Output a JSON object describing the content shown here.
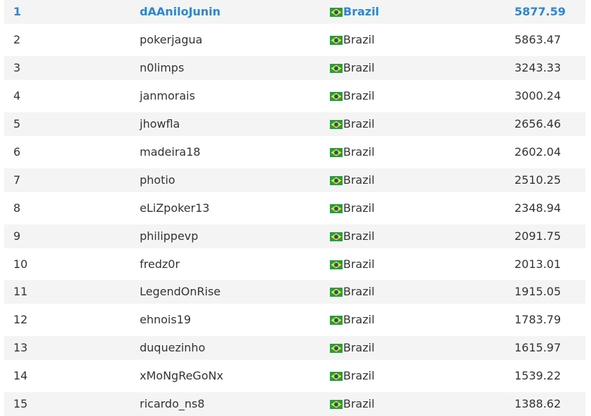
{
  "leaderboard": {
    "rows": [
      {
        "rank": "1",
        "player": "dAAniloJunin",
        "country": "Brazil",
        "score": "5877.59"
      },
      {
        "rank": "2",
        "player": "pokerjagua",
        "country": "Brazil",
        "score": "5863.47"
      },
      {
        "rank": "3",
        "player": "n0limps",
        "country": "Brazil",
        "score": "3243.33"
      },
      {
        "rank": "4",
        "player": "janmorais",
        "country": "Brazil",
        "score": "3000.24"
      },
      {
        "rank": "5",
        "player": "jhowfla",
        "country": "Brazil",
        "score": "2656.46"
      },
      {
        "rank": "6",
        "player": "madeira18",
        "country": "Brazil",
        "score": "2602.04"
      },
      {
        "rank": "7",
        "player": "photio",
        "country": "Brazil",
        "score": "2510.25"
      },
      {
        "rank": "8",
        "player": "eLiZpoker13",
        "country": "Brazil",
        "score": "2348.94"
      },
      {
        "rank": "9",
        "player": "philippevp",
        "country": "Brazil",
        "score": "2091.75"
      },
      {
        "rank": "10",
        "player": "fredz0r",
        "country": "Brazil",
        "score": "2013.01"
      },
      {
        "rank": "11",
        "player": "LegendOnRise",
        "country": "Brazil",
        "score": "1915.05"
      },
      {
        "rank": "12",
        "player": "ehnois19",
        "country": "Brazil",
        "score": "1783.79"
      },
      {
        "rank": "13",
        "player": "duquezinho",
        "country": "Brazil",
        "score": "1615.97"
      },
      {
        "rank": "14",
        "player": "xMoNgReGoNx",
        "country": "Brazil",
        "score": "1539.22"
      },
      {
        "rank": "15",
        "player": "ricardo_ns8",
        "country": "Brazil",
        "score": "1388.62"
      }
    ],
    "flag_icon": "brazil-flag-icon",
    "colors": {
      "leader_text": "#2a87d6",
      "row_shade": "#f4f4f4",
      "text": "#333333",
      "flag_green": "#229e45",
      "flag_yellow": "#f8e509",
      "flag_blue": "#2b49a3"
    }
  }
}
